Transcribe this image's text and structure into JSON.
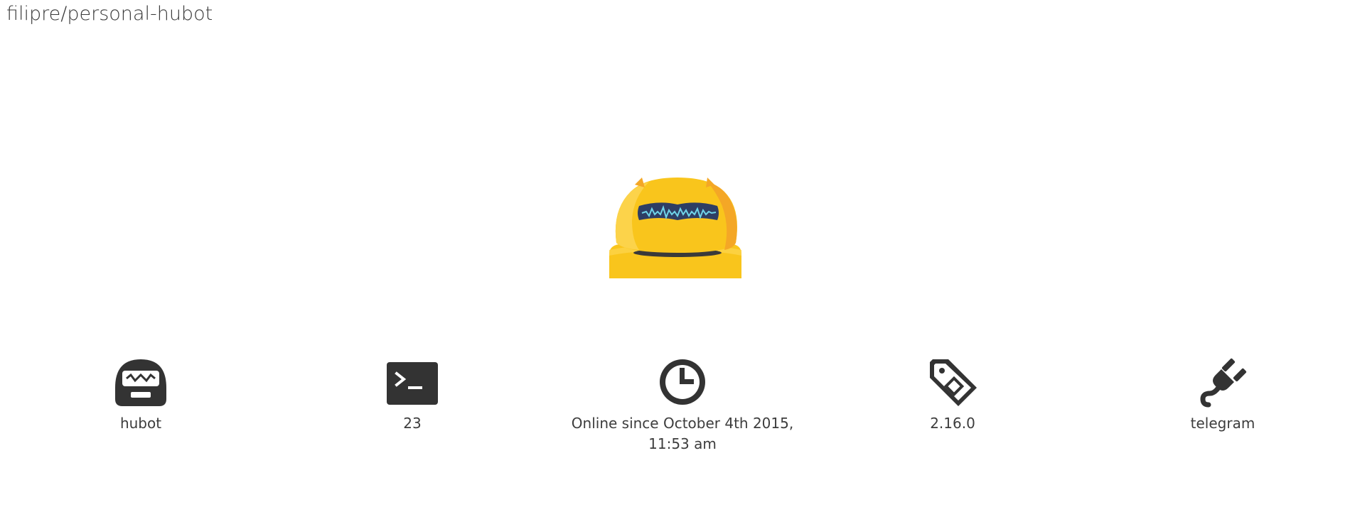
{
  "header": {
    "title": "filipre/personal-hubot"
  },
  "stats": {
    "name": {
      "icon": "hubot-face-icon",
      "label": "hubot"
    },
    "commands": {
      "icon": "terminal-icon",
      "label": "23"
    },
    "uptime": {
      "icon": "clock-icon",
      "label": "Online since October 4th 2015, 11:53 am"
    },
    "version": {
      "icon": "tag-icon",
      "label": "2.16.0"
    },
    "adapter": {
      "icon": "plug-icon",
      "label": "telegram"
    }
  },
  "colors": {
    "robot_yellow": "#f9c51c",
    "robot_dark_yellow": "#f4a726",
    "visor": "#2e3e64",
    "wave": "#6fd3e8",
    "icon_dark": "#333333"
  }
}
